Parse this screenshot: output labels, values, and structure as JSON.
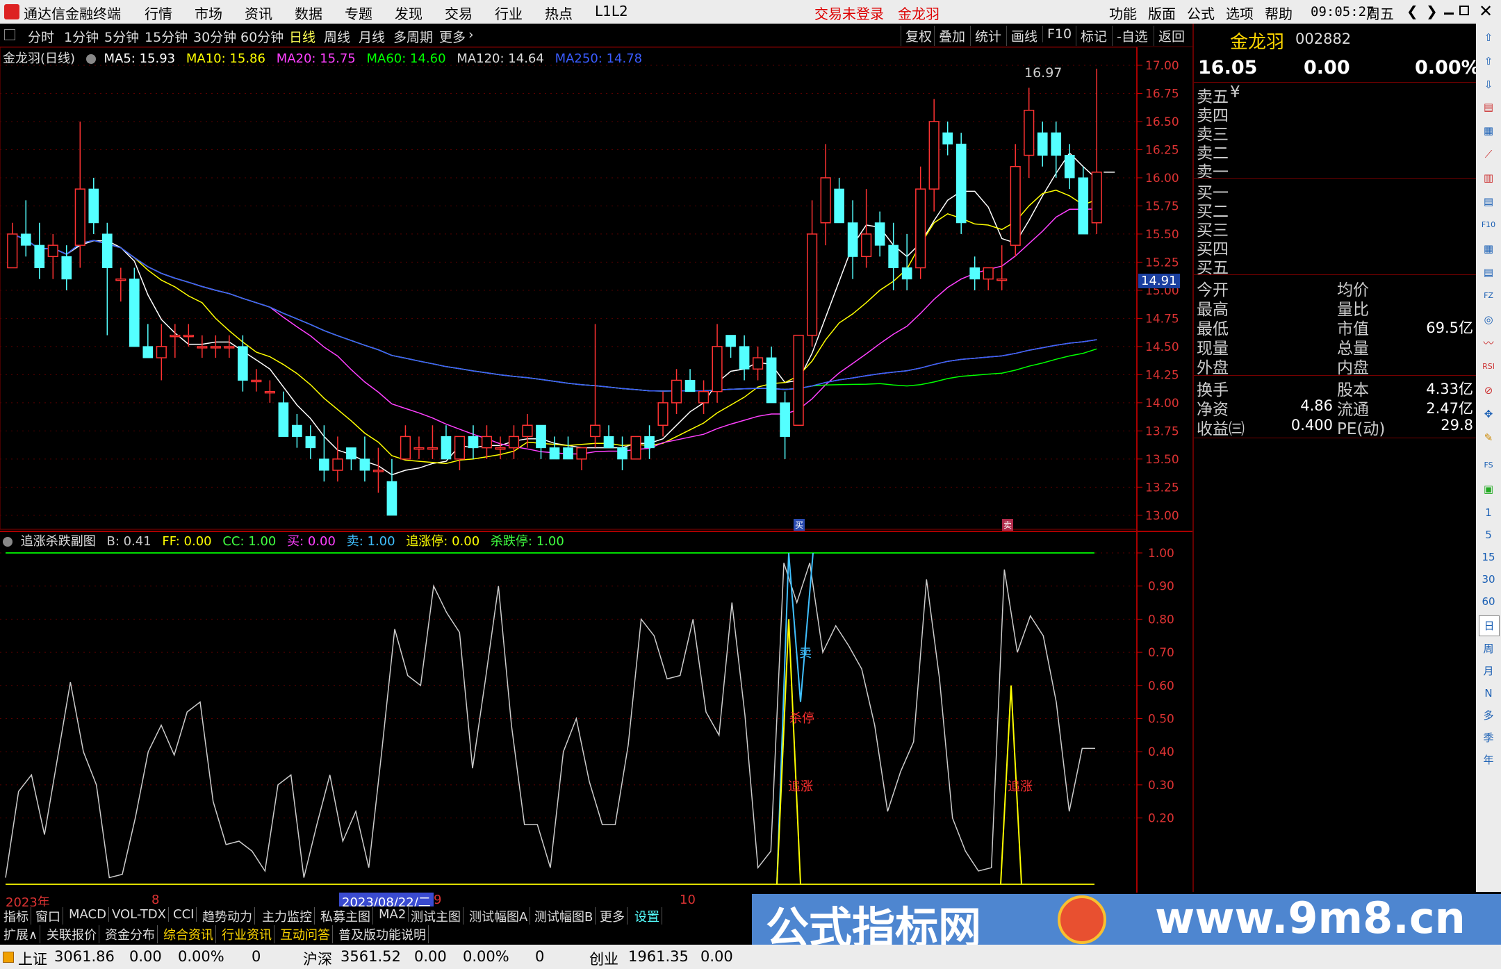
{
  "menubar": {
    "app_title": "通达信金融终端",
    "items": [
      "行情",
      "市场",
      "资讯",
      "数据",
      "专题",
      "发现",
      "交易",
      "行业",
      "热点",
      "L1L2"
    ],
    "login": "交易未登录",
    "stock": "金龙羽",
    "right_items": [
      "功能",
      "版面",
      "公式",
      "选项",
      "帮助"
    ],
    "time": "09:05:27",
    "weekday": "周五",
    "nav_back": "❮",
    "nav_fwd": "❯"
  },
  "periodbar": {
    "periods": [
      "分时",
      "1分钟",
      "5分钟",
      "15分钟",
      "30分钟",
      "60分钟",
      "日线",
      "周线",
      "月线",
      "多周期",
      "更多"
    ],
    "active": "日线",
    "tools": [
      "复权",
      "叠加",
      "统计",
      "画线",
      "F10",
      "标记",
      "-自选",
      "返回"
    ]
  },
  "main_chart": {
    "title": "金龙羽(日线)",
    "ma": [
      {
        "label": "MA5: 15.93",
        "color": "#ffffff"
      },
      {
        "label": "MA10: 15.86",
        "color": "#ffff00"
      },
      {
        "label": "MA20: 15.75",
        "color": "#ff40ff"
      },
      {
        "label": "MA60: 14.60",
        "color": "#00ff00"
      },
      {
        "label": "MA120: 14.64",
        "color": "#dddddd"
      },
      {
        "label": "MA250: 14.78",
        "color": "#3a5cff"
      }
    ],
    "high_label": "16.97",
    "price_marker": "14.91",
    "buy_tag": "买",
    "sell_tag": "卖"
  },
  "sub_chart": {
    "title": "追涨杀跌副图",
    "params": [
      {
        "label": "B: 0.41",
        "color": "#cccccc"
      },
      {
        "label": "FF: 0.00",
        "color": "#ffff00"
      },
      {
        "label": "CC: 1.00",
        "color": "#40ff40"
      },
      {
        "label": "买: 0.00",
        "color": "#ff40ff"
      },
      {
        "label": "卖: 1.00",
        "color": "#40c0ff"
      },
      {
        "label": "追涨停: 0.00",
        "color": "#ffff00"
      },
      {
        "label": "杀跌停: 1.00",
        "color": "#40ff40"
      }
    ],
    "annotations": {
      "sell": "卖",
      "sell_stop": "杀停",
      "chase1": "追涨",
      "chase2": "追涨"
    }
  },
  "chart_data": [
    {
      "type": "candlestick",
      "title": "金龙羽(日线)",
      "y_ticks": [
        "17.00",
        "16.75",
        "16.50",
        "16.25",
        "16.00",
        "15.75",
        "15.50",
        "15.25",
        "15.00",
        "14.75",
        "14.50",
        "14.25",
        "14.00",
        "13.75",
        "13.50",
        "13.25",
        "13.00"
      ],
      "ylim": [
        12.9,
        17.0
      ],
      "ohlc": [
        [
          15.2,
          15.6,
          15.2,
          15.5
        ],
        [
          15.5,
          15.8,
          15.3,
          15.4
        ],
        [
          15.4,
          15.6,
          15.1,
          15.2
        ],
        [
          15.3,
          15.5,
          15.1,
          15.4
        ],
        [
          15.3,
          15.4,
          15.0,
          15.1
        ],
        [
          15.4,
          16.5,
          15.2,
          15.9
        ],
        [
          15.9,
          16.0,
          15.5,
          15.6
        ],
        [
          15.5,
          15.6,
          14.6,
          15.2
        ],
        [
          15.1,
          15.2,
          14.9,
          15.1
        ],
        [
          15.1,
          15.2,
          14.5,
          14.5
        ],
        [
          14.5,
          14.7,
          14.4,
          14.4
        ],
        [
          14.4,
          14.7,
          14.2,
          14.5
        ],
        [
          14.6,
          14.7,
          14.4,
          14.6
        ],
        [
          14.6,
          14.7,
          14.5,
          14.6
        ],
        [
          14.5,
          14.6,
          14.4,
          14.5
        ],
        [
          14.5,
          14.6,
          14.4,
          14.5
        ],
        [
          14.5,
          14.6,
          14.4,
          14.5
        ],
        [
          14.5,
          14.6,
          14.1,
          14.2
        ],
        [
          14.2,
          14.3,
          14.1,
          14.2
        ],
        [
          14.1,
          14.2,
          14.0,
          14.1
        ],
        [
          14.0,
          14.1,
          13.7,
          13.7
        ],
        [
          13.8,
          13.9,
          13.6,
          13.7
        ],
        [
          13.7,
          13.8,
          13.5,
          13.6
        ],
        [
          13.5,
          13.8,
          13.3,
          13.4
        ],
        [
          13.4,
          13.7,
          13.3,
          13.5
        ],
        [
          13.6,
          13.6,
          13.4,
          13.5
        ],
        [
          13.5,
          13.7,
          13.3,
          13.4
        ],
        [
          13.4,
          13.6,
          13.2,
          13.4
        ],
        [
          13.3,
          13.5,
          13.0,
          13.0
        ],
        [
          13.5,
          13.8,
          13.5,
          13.7
        ],
        [
          13.6,
          13.7,
          13.5,
          13.6
        ],
        [
          13.6,
          13.8,
          13.5,
          13.6
        ],
        [
          13.7,
          13.8,
          13.5,
          13.5
        ],
        [
          13.5,
          13.7,
          13.4,
          13.7
        ],
        [
          13.7,
          13.8,
          13.5,
          13.6
        ],
        [
          13.6,
          13.8,
          13.5,
          13.7
        ],
        [
          13.6,
          13.7,
          13.5,
          13.6
        ],
        [
          13.6,
          13.8,
          13.5,
          13.7
        ],
        [
          13.7,
          13.9,
          13.6,
          13.8
        ],
        [
          13.8,
          13.8,
          13.5,
          13.6
        ],
        [
          13.6,
          13.7,
          13.5,
          13.5
        ],
        [
          13.6,
          13.7,
          13.5,
          13.5
        ],
        [
          13.5,
          13.6,
          13.4,
          13.6
        ],
        [
          13.7,
          14.7,
          13.6,
          13.8
        ],
        [
          13.7,
          13.8,
          13.6,
          13.6
        ],
        [
          13.6,
          13.7,
          13.4,
          13.5
        ],
        [
          13.5,
          13.7,
          13.5,
          13.7
        ],
        [
          13.7,
          13.8,
          13.5,
          13.6
        ],
        [
          13.8,
          14.1,
          13.7,
          14.0
        ],
        [
          14.0,
          14.3,
          13.9,
          14.2
        ],
        [
          14.2,
          14.3,
          14.1,
          14.1
        ],
        [
          14.0,
          14.2,
          13.9,
          14.1
        ],
        [
          14.1,
          14.7,
          14.0,
          14.5
        ],
        [
          14.6,
          14.6,
          14.4,
          14.5
        ],
        [
          14.5,
          14.6,
          14.2,
          14.3
        ],
        [
          14.3,
          14.5,
          14.2,
          14.4
        ],
        [
          14.4,
          14.5,
          14.0,
          14.0
        ],
        [
          14.0,
          14.1,
          13.5,
          13.7
        ],
        [
          13.8,
          14.6,
          13.8,
          14.6
        ],
        [
          14.6,
          15.8,
          14.5,
          15.5
        ],
        [
          15.6,
          16.3,
          15.4,
          16.0
        ],
        [
          15.9,
          16.0,
          15.6,
          15.6
        ],
        [
          15.6,
          15.8,
          15.1,
          15.3
        ],
        [
          15.3,
          15.9,
          15.2,
          15.5
        ],
        [
          15.6,
          15.7,
          15.3,
          15.4
        ],
        [
          15.4,
          15.6,
          15.0,
          15.2
        ],
        [
          15.2,
          15.5,
          15.0,
          15.1
        ],
        [
          15.2,
          16.1,
          15.1,
          15.9
        ],
        [
          15.9,
          16.7,
          15.7,
          16.5
        ],
        [
          16.4,
          16.5,
          16.2,
          16.3
        ],
        [
          16.3,
          16.4,
          15.5,
          15.6
        ],
        [
          15.2,
          15.3,
          15.0,
          15.1
        ],
        [
          15.1,
          15.2,
          15.0,
          15.2
        ],
        [
          15.1,
          15.4,
          15.0,
          15.1
        ],
        [
          15.4,
          16.3,
          15.3,
          16.1
        ],
        [
          16.2,
          16.8,
          16.0,
          16.6
        ],
        [
          16.4,
          16.5,
          16.1,
          16.2
        ],
        [
          16.4,
          16.5,
          16.0,
          16.2
        ],
        [
          16.2,
          16.3,
          15.9,
          16.0
        ],
        [
          16.0,
          16.1,
          15.5,
          15.5
        ],
        [
          15.6,
          16.97,
          15.5,
          16.05
        ]
      ]
    },
    {
      "type": "line",
      "title": "追涨杀跌副图",
      "y_ticks": [
        "1.00",
        "0.90",
        "0.80",
        "0.70",
        "0.60",
        "0.50",
        "0.40",
        "0.30",
        "0.20"
      ],
      "ylim": [
        0.0,
        1.0
      ],
      "series": [
        {
          "name": "B",
          "color": "#cccccc",
          "values": [
            0.02,
            0.28,
            0.33,
            0.15,
            0.38,
            0.61,
            0.4,
            0.3,
            0.02,
            0.03,
            0.2,
            0.4,
            0.48,
            0.39,
            0.52,
            0.55,
            0.25,
            0.12,
            0.13,
            0.1,
            0.04,
            0.3,
            0.33,
            0.02,
            0.18,
            0.33,
            0.13,
            0.22,
            0.05,
            0.4,
            0.77,
            0.63,
            0.6,
            0.9,
            0.82,
            0.76,
            0.35,
            0.62,
            0.9,
            0.48,
            0.18,
            0.18,
            0.05,
            0.4,
            0.5,
            0.31,
            0.18,
            0.18,
            0.42,
            0.8,
            0.75,
            0.62,
            0.63,
            0.8,
            0.52,
            0.45,
            0.85,
            0.51,
            0.05,
            0.1,
            0.97,
            0.85,
            0.97,
            0.7,
            0.78,
            0.72,
            0.65,
            0.48,
            0.22,
            0.34,
            0.43,
            0.92,
            0.62,
            0.2,
            0.1,
            0.04,
            0.05,
            0.95,
            0.7,
            0.81,
            0.75,
            0.55,
            0.22,
            0.41,
            0.41
          ]
        },
        {
          "name": "卖",
          "color": "#40c0ff",
          "values": [
            0.0,
            1.0,
            0.55,
            1.0
          ]
        },
        {
          "name": "追涨停",
          "color": "#ffff00",
          "values": [
            0.0,
            0.8,
            0.0,
            0.0,
            0.6,
            0.0
          ]
        }
      ]
    }
  ],
  "date_axis": {
    "labels": [
      "2023年",
      "8",
      "2023/08/22/二",
      "9",
      "10"
    ]
  },
  "quote_panel": {
    "stock_name": "金龙羽",
    "code": "002882",
    "price": "16.05",
    "change": "0.00",
    "pct": "0.00%",
    "asks": [
      "卖五",
      "卖四",
      "卖三",
      "卖二",
      "卖一"
    ],
    "ask5_extra": "¥",
    "bids": [
      "买一",
      "买二",
      "买三",
      "买四",
      "买五"
    ],
    "stats_left": [
      {
        "k": "今开",
        "v": ""
      },
      {
        "k": "最高",
        "v": ""
      },
      {
        "k": "最低",
        "v": ""
      },
      {
        "k": "现量",
        "v": ""
      },
      {
        "k": "外盘",
        "v": ""
      }
    ],
    "stats_right": [
      {
        "k": "均价",
        "v": ""
      },
      {
        "k": "量比",
        "v": ""
      },
      {
        "k": "市值",
        "v": "69.5亿"
      },
      {
        "k": "总量",
        "v": ""
      },
      {
        "k": "内盘",
        "v": ""
      }
    ],
    "fund_left": [
      {
        "k": "换手",
        "v": ""
      },
      {
        "k": "净资",
        "v": "4.86"
      },
      {
        "k": "收益㈢",
        "v": "0.400"
      }
    ],
    "fund_right": [
      {
        "k": "股本",
        "v": "4.33亿"
      },
      {
        "k": "流通",
        "v": "2.47亿"
      },
      {
        "k": "PE(动)",
        "v": "29.8"
      }
    ]
  },
  "iconstrip": {
    "labels": [
      "1",
      "5",
      "15",
      "30",
      "60",
      "日",
      "周",
      "月",
      "N",
      "多",
      "季",
      "年"
    ]
  },
  "tabs1": [
    "指标",
    "窗口",
    "MACD",
    "VOL-TDX",
    "CCI",
    "趋势动力",
    "主力监控",
    "私募主图",
    "MA2",
    "测试主图",
    "测试幅图A",
    "测试幅图B",
    "更多",
    "设置"
  ],
  "tabs2": [
    "扩展∧",
    "关联报价",
    "资金分布",
    "综合资讯",
    "行业资讯",
    "互动问答",
    "普及版功能说明"
  ],
  "statusbar": {
    "sh_name": "上证",
    "sh_val": "3061.86",
    "sh_chg": "0.00",
    "sh_pct": "0.00%",
    "sh_vol": "0",
    "hs_name": "沪深",
    "hs_val": "3561.52",
    "hs_chg": "0.00",
    "hs_pct": "0.00%",
    "hs_vol": "0",
    "cy_name": "创业",
    "cy_val": "1961.35",
    "cy_chg": "0.00"
  },
  "watermark": {
    "text1": "公式指标网",
    "text2": "www.9m8.cn"
  }
}
